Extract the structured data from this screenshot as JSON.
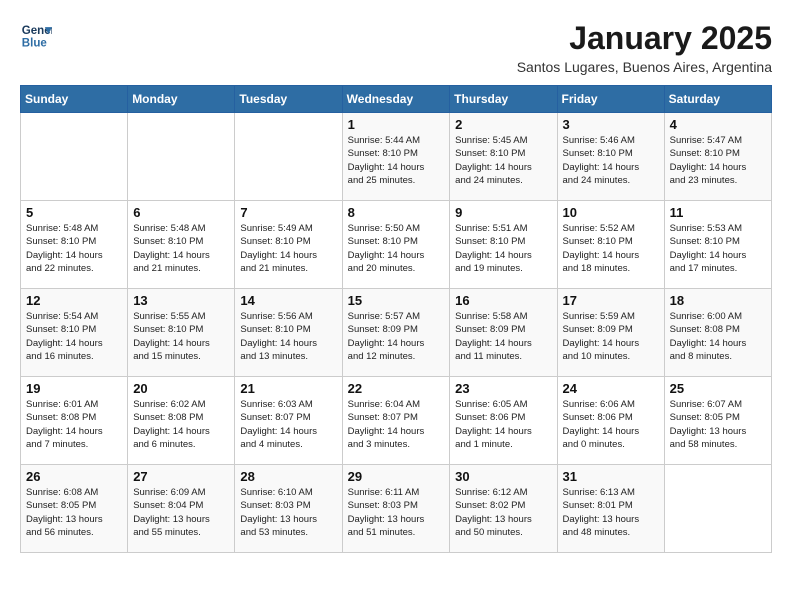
{
  "logo": {
    "line1": "General",
    "line2": "Blue"
  },
  "title": "January 2025",
  "subtitle": "Santos Lugares, Buenos Aires, Argentina",
  "days_of_week": [
    "Sunday",
    "Monday",
    "Tuesday",
    "Wednesday",
    "Thursday",
    "Friday",
    "Saturday"
  ],
  "weeks": [
    [
      {
        "num": "",
        "info": ""
      },
      {
        "num": "",
        "info": ""
      },
      {
        "num": "",
        "info": ""
      },
      {
        "num": "1",
        "info": "Sunrise: 5:44 AM\nSunset: 8:10 PM\nDaylight: 14 hours\nand 25 minutes."
      },
      {
        "num": "2",
        "info": "Sunrise: 5:45 AM\nSunset: 8:10 PM\nDaylight: 14 hours\nand 24 minutes."
      },
      {
        "num": "3",
        "info": "Sunrise: 5:46 AM\nSunset: 8:10 PM\nDaylight: 14 hours\nand 24 minutes."
      },
      {
        "num": "4",
        "info": "Sunrise: 5:47 AM\nSunset: 8:10 PM\nDaylight: 14 hours\nand 23 minutes."
      }
    ],
    [
      {
        "num": "5",
        "info": "Sunrise: 5:48 AM\nSunset: 8:10 PM\nDaylight: 14 hours\nand 22 minutes."
      },
      {
        "num": "6",
        "info": "Sunrise: 5:48 AM\nSunset: 8:10 PM\nDaylight: 14 hours\nand 21 minutes."
      },
      {
        "num": "7",
        "info": "Sunrise: 5:49 AM\nSunset: 8:10 PM\nDaylight: 14 hours\nand 21 minutes."
      },
      {
        "num": "8",
        "info": "Sunrise: 5:50 AM\nSunset: 8:10 PM\nDaylight: 14 hours\nand 20 minutes."
      },
      {
        "num": "9",
        "info": "Sunrise: 5:51 AM\nSunset: 8:10 PM\nDaylight: 14 hours\nand 19 minutes."
      },
      {
        "num": "10",
        "info": "Sunrise: 5:52 AM\nSunset: 8:10 PM\nDaylight: 14 hours\nand 18 minutes."
      },
      {
        "num": "11",
        "info": "Sunrise: 5:53 AM\nSunset: 8:10 PM\nDaylight: 14 hours\nand 17 minutes."
      }
    ],
    [
      {
        "num": "12",
        "info": "Sunrise: 5:54 AM\nSunset: 8:10 PM\nDaylight: 14 hours\nand 16 minutes."
      },
      {
        "num": "13",
        "info": "Sunrise: 5:55 AM\nSunset: 8:10 PM\nDaylight: 14 hours\nand 15 minutes."
      },
      {
        "num": "14",
        "info": "Sunrise: 5:56 AM\nSunset: 8:10 PM\nDaylight: 14 hours\nand 13 minutes."
      },
      {
        "num": "15",
        "info": "Sunrise: 5:57 AM\nSunset: 8:09 PM\nDaylight: 14 hours\nand 12 minutes."
      },
      {
        "num": "16",
        "info": "Sunrise: 5:58 AM\nSunset: 8:09 PM\nDaylight: 14 hours\nand 11 minutes."
      },
      {
        "num": "17",
        "info": "Sunrise: 5:59 AM\nSunset: 8:09 PM\nDaylight: 14 hours\nand 10 minutes."
      },
      {
        "num": "18",
        "info": "Sunrise: 6:00 AM\nSunset: 8:08 PM\nDaylight: 14 hours\nand 8 minutes."
      }
    ],
    [
      {
        "num": "19",
        "info": "Sunrise: 6:01 AM\nSunset: 8:08 PM\nDaylight: 14 hours\nand 7 minutes."
      },
      {
        "num": "20",
        "info": "Sunrise: 6:02 AM\nSunset: 8:08 PM\nDaylight: 14 hours\nand 6 minutes."
      },
      {
        "num": "21",
        "info": "Sunrise: 6:03 AM\nSunset: 8:07 PM\nDaylight: 14 hours\nand 4 minutes."
      },
      {
        "num": "22",
        "info": "Sunrise: 6:04 AM\nSunset: 8:07 PM\nDaylight: 14 hours\nand 3 minutes."
      },
      {
        "num": "23",
        "info": "Sunrise: 6:05 AM\nSunset: 8:06 PM\nDaylight: 14 hours\nand 1 minute."
      },
      {
        "num": "24",
        "info": "Sunrise: 6:06 AM\nSunset: 8:06 PM\nDaylight: 14 hours\nand 0 minutes."
      },
      {
        "num": "25",
        "info": "Sunrise: 6:07 AM\nSunset: 8:05 PM\nDaylight: 13 hours\nand 58 minutes."
      }
    ],
    [
      {
        "num": "26",
        "info": "Sunrise: 6:08 AM\nSunset: 8:05 PM\nDaylight: 13 hours\nand 56 minutes."
      },
      {
        "num": "27",
        "info": "Sunrise: 6:09 AM\nSunset: 8:04 PM\nDaylight: 13 hours\nand 55 minutes."
      },
      {
        "num": "28",
        "info": "Sunrise: 6:10 AM\nSunset: 8:03 PM\nDaylight: 13 hours\nand 53 minutes."
      },
      {
        "num": "29",
        "info": "Sunrise: 6:11 AM\nSunset: 8:03 PM\nDaylight: 13 hours\nand 51 minutes."
      },
      {
        "num": "30",
        "info": "Sunrise: 6:12 AM\nSunset: 8:02 PM\nDaylight: 13 hours\nand 50 minutes."
      },
      {
        "num": "31",
        "info": "Sunrise: 6:13 AM\nSunset: 8:01 PM\nDaylight: 13 hours\nand 48 minutes."
      },
      {
        "num": "",
        "info": ""
      }
    ]
  ]
}
